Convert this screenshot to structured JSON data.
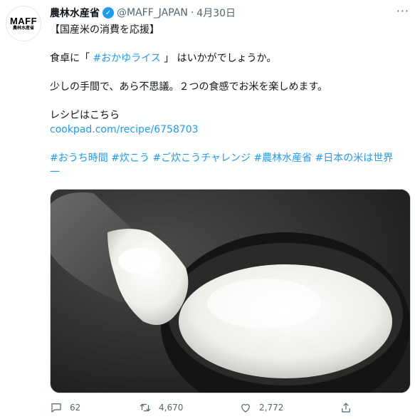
{
  "author": {
    "logo_text": "MAFF",
    "logo_subtext": "農林水産省",
    "name": "農林水産省",
    "handle": "@MAFF_JAPAN",
    "separator": "·",
    "date": "4月30日"
  },
  "tweet": {
    "line1": "【国産米の消費を応援】",
    "line2_pre": "食卓に「 ",
    "line2_tag": "#おかゆライス",
    "line2_post": " 」 はいかがでしょうか。",
    "line3": "少しの手間で、あら不思議。２つの食感でお米を楽しめます。",
    "line4": "レシピはこちら",
    "link": "cookpad.com/recipe/6758703",
    "hashtags_line1": "#おうち時間 #炊こう #ご炊こうチャレンジ #農林水産省 #日本の米は世界",
    "hashtags_line2": "一"
  },
  "actions": {
    "replies": "62",
    "retweets": "4,670",
    "likes": "2,772"
  },
  "colors": {
    "link": "#1d9bf0",
    "secondary_text": "#536471",
    "verified": "#1d9bf0"
  }
}
